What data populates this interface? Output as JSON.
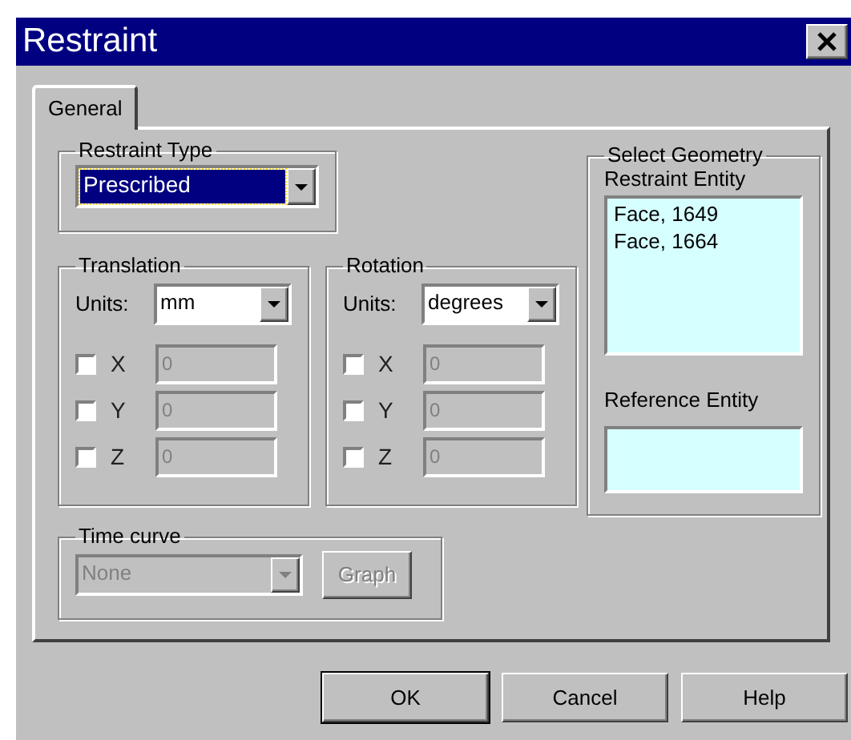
{
  "window": {
    "title": "Restraint"
  },
  "tabs": [
    {
      "label": "General",
      "selected": true
    }
  ],
  "restraint_type": {
    "label": "Restraint Type",
    "value": "Prescribed"
  },
  "translation": {
    "label": "Translation",
    "units_label": "Units:",
    "units": "mm",
    "axes": [
      {
        "label": "X",
        "checked": false,
        "value": "0",
        "disabled": true
      },
      {
        "label": "Y",
        "checked": false,
        "value": "0",
        "disabled": true
      },
      {
        "label": "Z",
        "checked": false,
        "value": "0",
        "disabled": true
      }
    ]
  },
  "rotation": {
    "label": "Rotation",
    "units_label": "Units:",
    "units": "degrees",
    "axes": [
      {
        "label": "X",
        "checked": false,
        "value": "0",
        "disabled": true
      },
      {
        "label": "Y",
        "checked": false,
        "value": "0",
        "disabled": true
      },
      {
        "label": "Z",
        "checked": false,
        "value": "0",
        "disabled": true
      }
    ]
  },
  "time_curve": {
    "label": "Time curve",
    "value": "None",
    "disabled": true,
    "button": "Graph"
  },
  "select_geometry": {
    "label": "Select Geometry",
    "restraint_entity": {
      "label": "Restraint Entity",
      "items": [
        "Face, 1649",
        "Face, 1664"
      ]
    },
    "reference_entity": {
      "label": "Reference Entity"
    }
  },
  "buttons": [
    {
      "label": "OK",
      "default": true
    },
    {
      "label": "Cancel",
      "default": false
    },
    {
      "label": "Help",
      "default": false
    }
  ]
}
